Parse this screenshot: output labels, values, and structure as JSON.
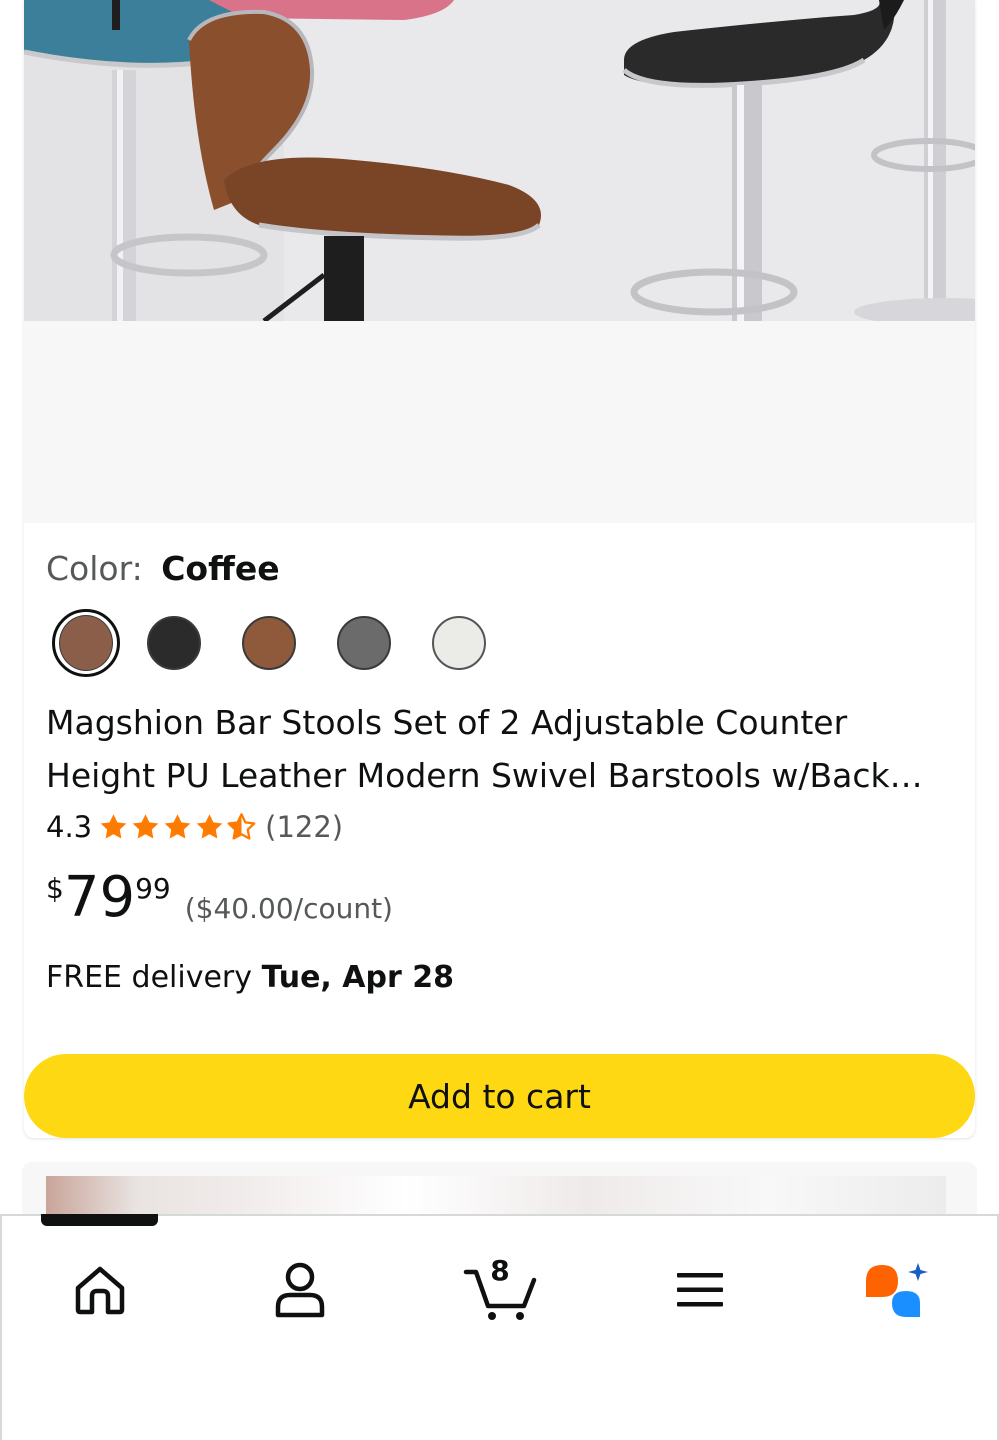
{
  "product": {
    "color_label": "Color:",
    "color_value": "Coffee",
    "swatches": [
      {
        "name": "Coffee",
        "color": "#8b5e4a",
        "selected": true
      },
      {
        "name": "Black",
        "color": "#2b2b2b",
        "selected": false
      },
      {
        "name": "Brown",
        "color": "#8f5a3c",
        "selected": false
      },
      {
        "name": "Gray",
        "color": "#6b6b6b",
        "selected": false
      },
      {
        "name": "White",
        "color": "#ebebe8",
        "selected": false
      }
    ],
    "title": "Magshion Bar Stools Set of 2 Adjustable Counter Height PU Leather Modern Swivel Barstools w/Back…",
    "rating": "4.3",
    "rating_stars": 4.3,
    "rating_count": "(122)",
    "price_currency": "$",
    "price_whole": "79",
    "price_fraction": "99",
    "unit_price": "($40.00/count)",
    "delivery_prefix": "FREE delivery",
    "delivery_date": "Tue, Apr 28",
    "add_to_cart_label": "Add to cart"
  },
  "nav": {
    "cart_count": "8",
    "items": [
      "home-icon",
      "account-icon",
      "cart-icon",
      "menu-icon",
      "rufus-icon"
    ]
  },
  "colors": {
    "star": "#ff7b00",
    "add_to_cart": "#ffd814",
    "rufus_orange": "#ff6200",
    "rufus_blue": "#1a8fff"
  }
}
